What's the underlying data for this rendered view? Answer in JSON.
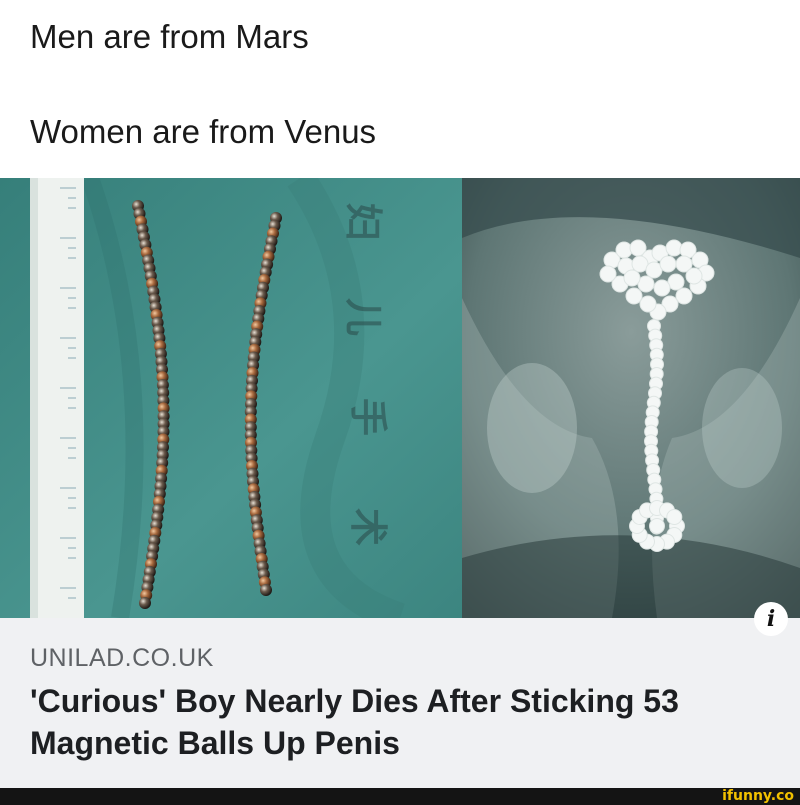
{
  "post": {
    "caption_line1": "Men are from Mars",
    "caption_line2": "Women are from Venus"
  },
  "link_card": {
    "domain": "UNILAD.CO.UK",
    "headline": "'Curious' Boy Nearly Dies After Sticking 53 Magnetic Balls Up Penis",
    "info_icon": "i"
  },
  "watermark": {
    "text": "ifunny.co"
  },
  "colors": {
    "surgical_drape": "#3f8a85",
    "xray_background": "#6f8a88",
    "card_background": "#f0f1f3",
    "watermark_yellow": "#f2c100"
  },
  "icons": [
    "info-icon",
    "ruler-icon",
    "magnetic-balls-image",
    "xray-image"
  ]
}
